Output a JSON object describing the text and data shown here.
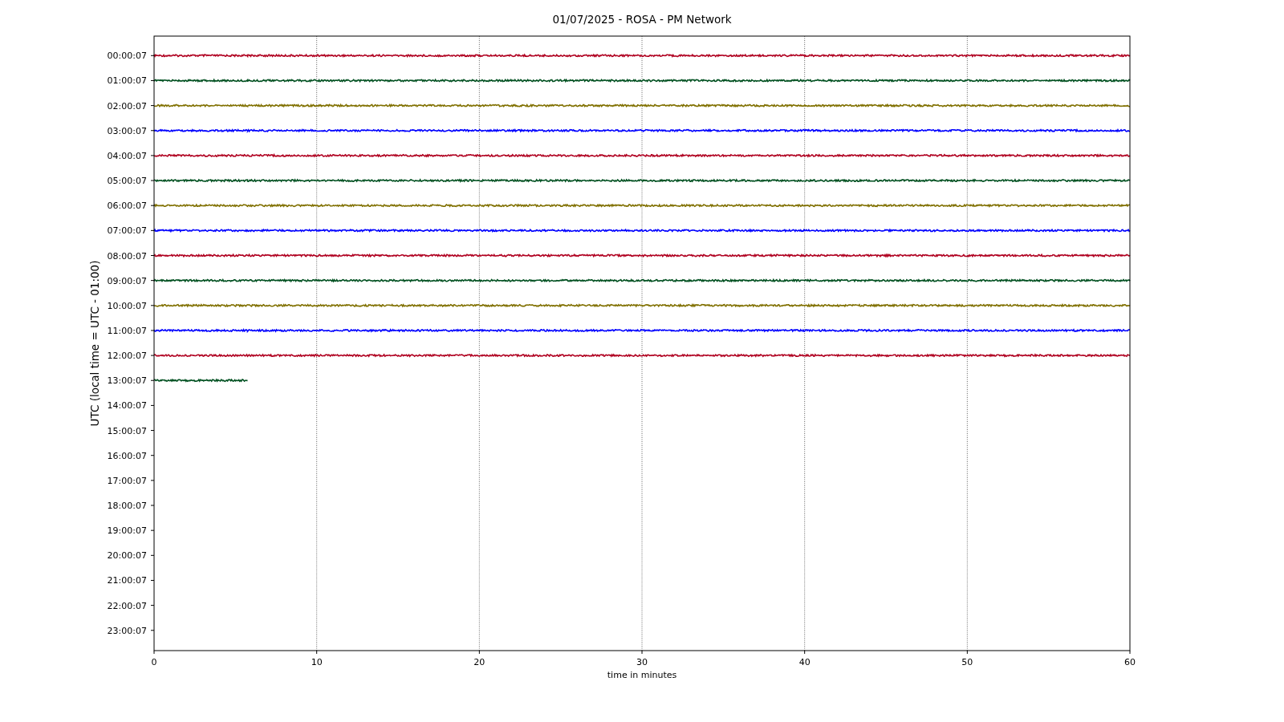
{
  "chart_data": {
    "type": "line",
    "title": "01/07/2025 - ROSA - PM Network",
    "xlabel": "time in minutes",
    "ylabel": "UTC (local time = UTC - 01:00)",
    "x": [
      0,
      5.75,
      60
    ],
    "grid": true,
    "xlim": [
      0,
      60
    ],
    "ylim": [
      85723,
      -2801
    ],
    "xticks": [
      0,
      10,
      20,
      30,
      40,
      50,
      60
    ],
    "yticks": [
      {
        "value": 7,
        "label": "00:00:07"
      },
      {
        "value": 3607,
        "label": "01:00:07"
      },
      {
        "value": 7207,
        "label": "02:00:07"
      },
      {
        "value": 10807,
        "label": "03:00:07"
      },
      {
        "value": 14407,
        "label": "04:00:07"
      },
      {
        "value": 18007,
        "label": "05:00:07"
      },
      {
        "value": 21607,
        "label": "06:00:07"
      },
      {
        "value": 25207,
        "label": "07:00:07"
      },
      {
        "value": 28807,
        "label": "08:00:07"
      },
      {
        "value": 32407,
        "label": "09:00:07"
      },
      {
        "value": 36007,
        "label": "10:00:07"
      },
      {
        "value": 39607,
        "label": "11:00:07"
      },
      {
        "value": 43207,
        "label": "12:00:07"
      },
      {
        "value": 46807,
        "label": "13:00:07"
      },
      {
        "value": 50407,
        "label": "14:00:07"
      },
      {
        "value": 54007,
        "label": "15:00:07"
      },
      {
        "value": 57607,
        "label": "16:00:07"
      },
      {
        "value": 61207,
        "label": "17:00:07"
      },
      {
        "value": 64807,
        "label": "18:00:07"
      },
      {
        "value": 68407,
        "label": "19:00:07"
      },
      {
        "value": 72007,
        "label": "20:00:07"
      },
      {
        "value": 75607,
        "label": "21:00:07"
      },
      {
        "value": 79207,
        "label": "22:00:07"
      },
      {
        "value": 82807,
        "label": "23:00:07"
      }
    ],
    "series": [
      {
        "color": "#b00020",
        "values": [
          7,
          7,
          7
        ]
      },
      {
        "color": "#005020",
        "values": [
          3607,
          3607,
          3607
        ]
      },
      {
        "color": "#807000",
        "values": [
          7207,
          7207,
          7207
        ]
      },
      {
        "color": "#0000ff",
        "values": [
          10807,
          10807,
          10807
        ]
      },
      {
        "color": "#b00020",
        "values": [
          14407,
          14407,
          14407
        ]
      },
      {
        "color": "#005020",
        "values": [
          18007,
          18007,
          18007
        ]
      },
      {
        "color": "#807000",
        "values": [
          21607,
          21607,
          21607
        ]
      },
      {
        "color": "#0000ff",
        "values": [
          25207,
          25207,
          25207
        ]
      },
      {
        "color": "#b00020",
        "values": [
          28807,
          28807,
          28807
        ]
      },
      {
        "color": "#005020",
        "values": [
          32407,
          32407,
          32407
        ]
      },
      {
        "color": "#807000",
        "values": [
          36007,
          36007,
          36007
        ]
      },
      {
        "color": "#0000ff",
        "values": [
          39607,
          39607,
          39607
        ]
      },
      {
        "color": "#b00020",
        "values": [
          43207,
          43207,
          43207
        ]
      },
      {
        "color": "#005020",
        "values": [
          46807,
          46807,
          null
        ]
      }
    ]
  }
}
